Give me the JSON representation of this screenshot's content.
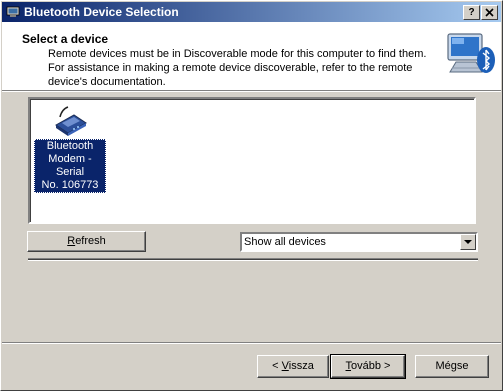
{
  "window": {
    "title": "Bluetooth Device Selection",
    "help_button": "?",
    "close_button": "X"
  },
  "header": {
    "title": "Select a device",
    "description": "Remote devices must be in Discoverable mode for this computer to find them. For assistance in making a remote device discoverable, refer to the remote device's documentation."
  },
  "devices": [
    {
      "label_line1": "Bluetooth",
      "label_line2": "Modem - Serial",
      "label_line3": "No. 106773",
      "icon": "modem-icon",
      "selected": true
    }
  ],
  "controls": {
    "refresh_prefix": "",
    "refresh_mnemonic": "R",
    "refresh_rest": "efresh",
    "filter_value": "Show all devices"
  },
  "footer": {
    "back_prefix": "< ",
    "back_mnemonic": "V",
    "back_rest": "issza",
    "next_mnemonic": "T",
    "next_rest": "ovább >",
    "cancel_label": "Mégse"
  },
  "colors": {
    "titlebar_start": "#0a246a",
    "titlebar_end": "#a6caf0",
    "selection": "#0a246a",
    "face": "#d4d0c8"
  }
}
